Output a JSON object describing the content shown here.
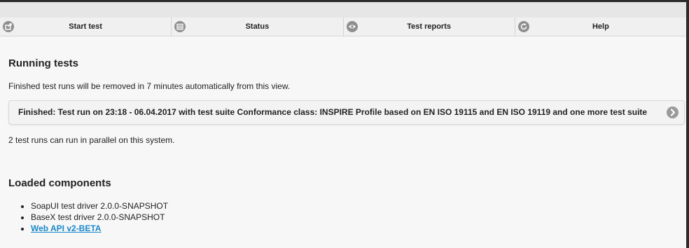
{
  "nav": {
    "items": [
      {
        "label": "Start test",
        "icon": "external-link-icon"
      },
      {
        "label": "Status",
        "icon": "calendar-icon"
      },
      {
        "label": "Test reports",
        "icon": "eye-icon"
      },
      {
        "label": "Help",
        "icon": "refresh-icon"
      }
    ]
  },
  "running": {
    "title": "Running tests",
    "removal_note": "Finished test runs will be removed in 7 minutes automatically from this view.",
    "run_item": "Finished: Test run on 23:18 - 06.04.2017 with test suite Conformance class: INSPIRE Profile based on EN ISO 19115 and EN ISO 19119 and one more test suite",
    "parallel_note": "2 test runs can run in parallel on this system."
  },
  "components": {
    "title": "Loaded components",
    "items": [
      "SoapUI test driver 2.0.0-SNAPSHOT",
      "BaseX test driver 2.0.0-SNAPSHOT"
    ],
    "link": "Web API v2-BETA"
  },
  "colors": {
    "link": "#1a88c9",
    "icon": "#8f8f8f"
  }
}
